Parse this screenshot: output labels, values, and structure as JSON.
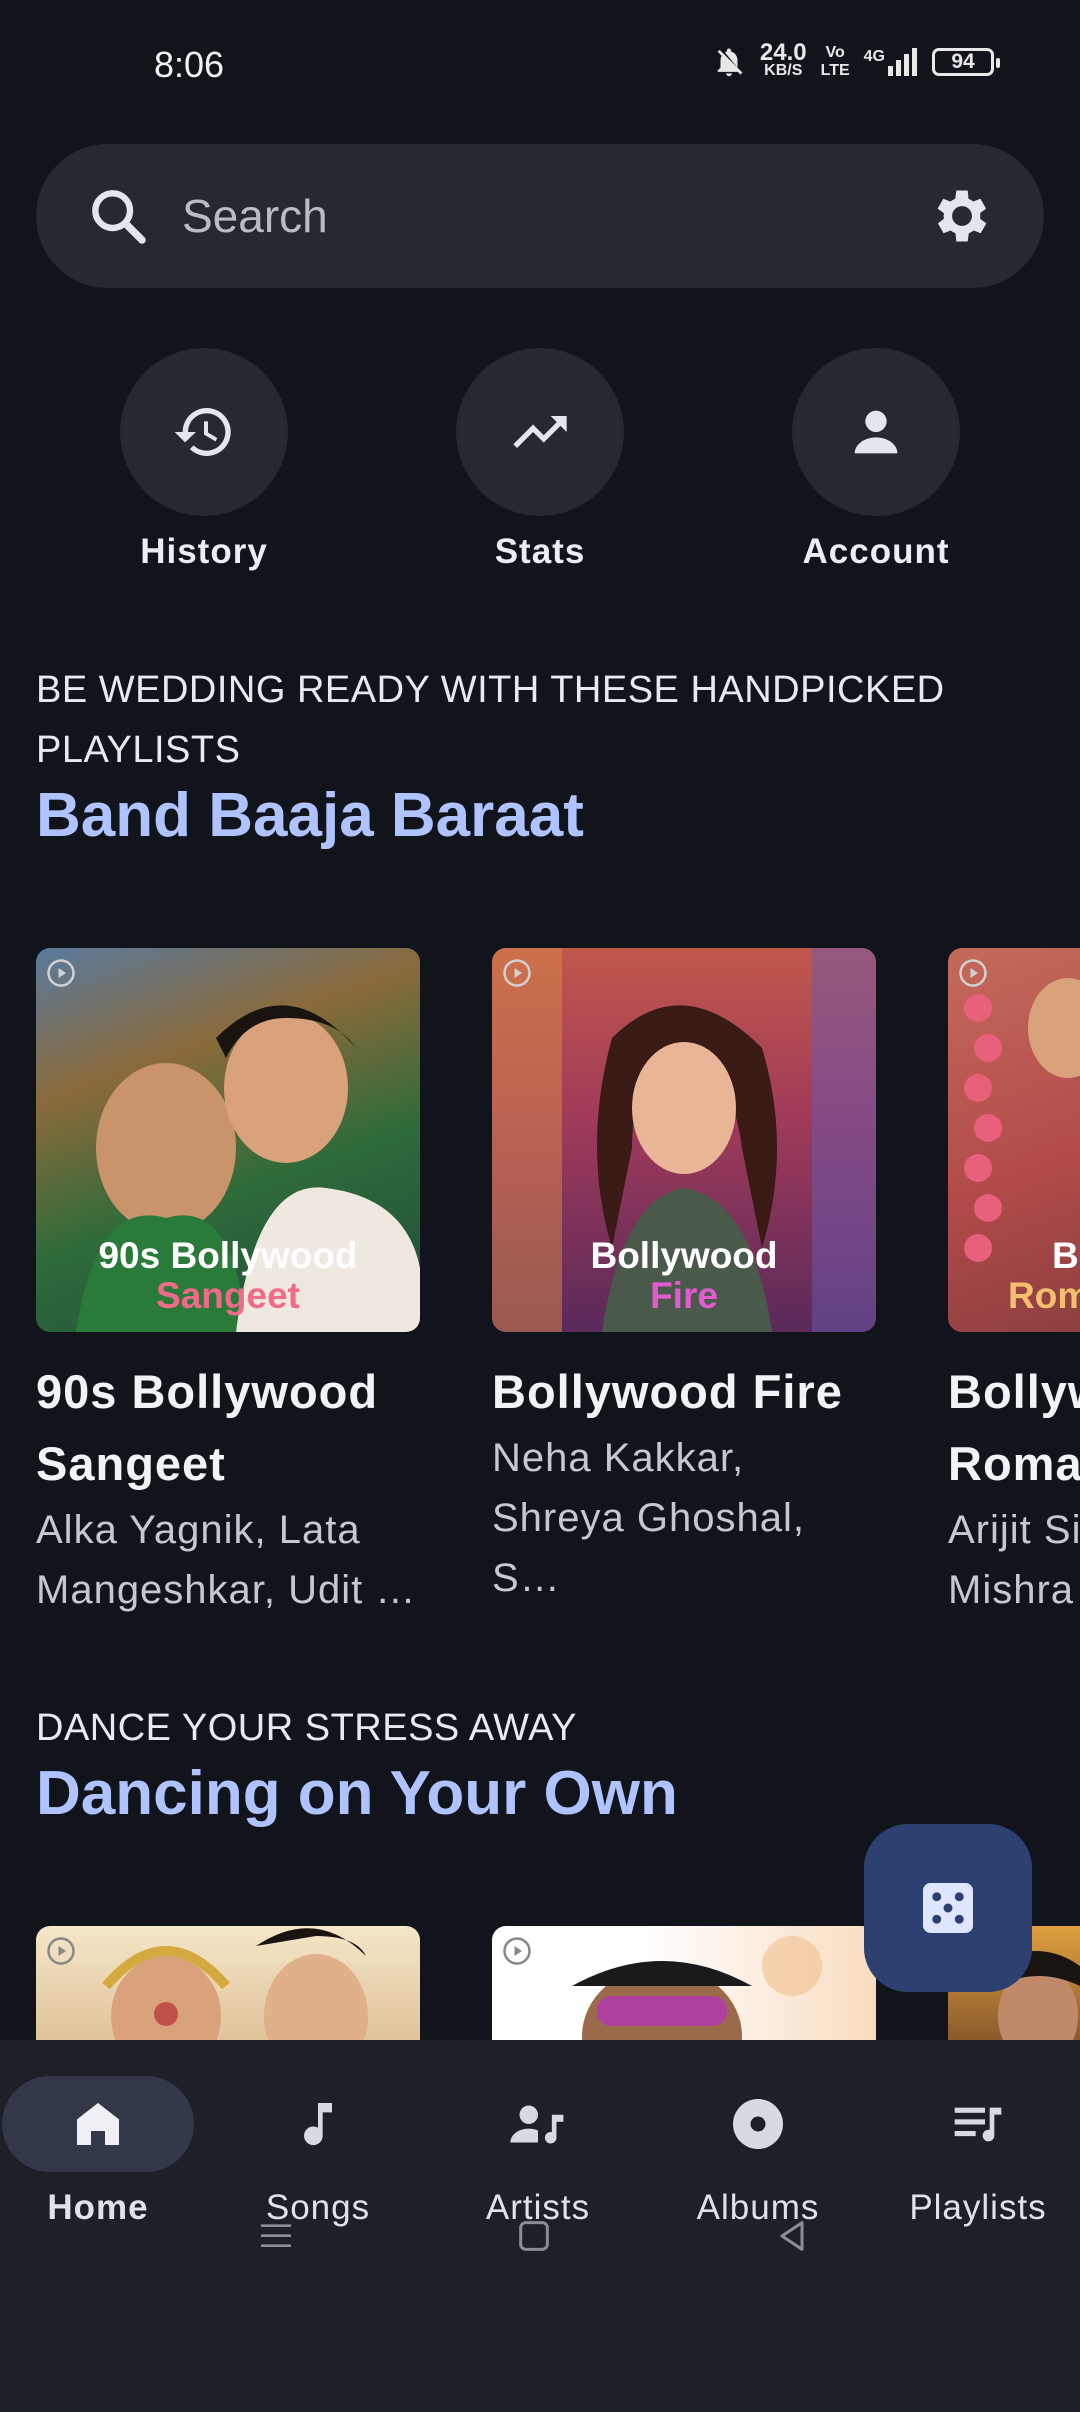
{
  "status_bar": {
    "time": "8:06",
    "net_speed_value": "24.0",
    "net_speed_unit": "KB/S",
    "volte_top": "Vo",
    "volte_bottom": "LTE",
    "network": "4G",
    "battery": "94"
  },
  "search": {
    "placeholder": "Search"
  },
  "quick_actions": [
    {
      "label": "History",
      "icon": "history-icon"
    },
    {
      "label": "Stats",
      "icon": "trending-up-icon"
    },
    {
      "label": "Account",
      "icon": "person-icon"
    }
  ],
  "sections": [
    {
      "subtitle": "BE WEDDING READY WITH THESE HANDPICKED PLAYLISTS",
      "title": "Band Baaja Baraat",
      "cards": [
        {
          "title": "90s Bollywood Sangeet",
          "artists": "Alka Yagnik, Lata Mangeshkar, Udit …",
          "cover_line1": "90s Bollywood",
          "cover_line2": "Sangeet"
        },
        {
          "title": "Bollywood Fire",
          "artists": "Neha Kakkar, Shreya Ghoshal, S…",
          "cover_line1": "Bollywood",
          "cover_line2": "Fire"
        },
        {
          "title": "Bollyw Roma",
          "artists": "Arijit Si Mishra",
          "cover_line1": "Bo",
          "cover_line2": "Rom"
        }
      ]
    },
    {
      "subtitle": "DANCE YOUR STRESS AWAY",
      "title": "Dancing on Your Own"
    }
  ],
  "bottom_nav": [
    {
      "label": "Home",
      "icon": "home-icon",
      "active": true
    },
    {
      "label": "Songs",
      "icon": "music-note-icon"
    },
    {
      "label": "Artists",
      "icon": "artist-icon"
    },
    {
      "label": "Albums",
      "icon": "album-icon"
    },
    {
      "label": "Playlists",
      "icon": "playlist-icon"
    }
  ],
  "colors": {
    "background": "#12141c",
    "surface": "#262932",
    "accent": "#aec3ff",
    "fab": "#2c4170"
  }
}
